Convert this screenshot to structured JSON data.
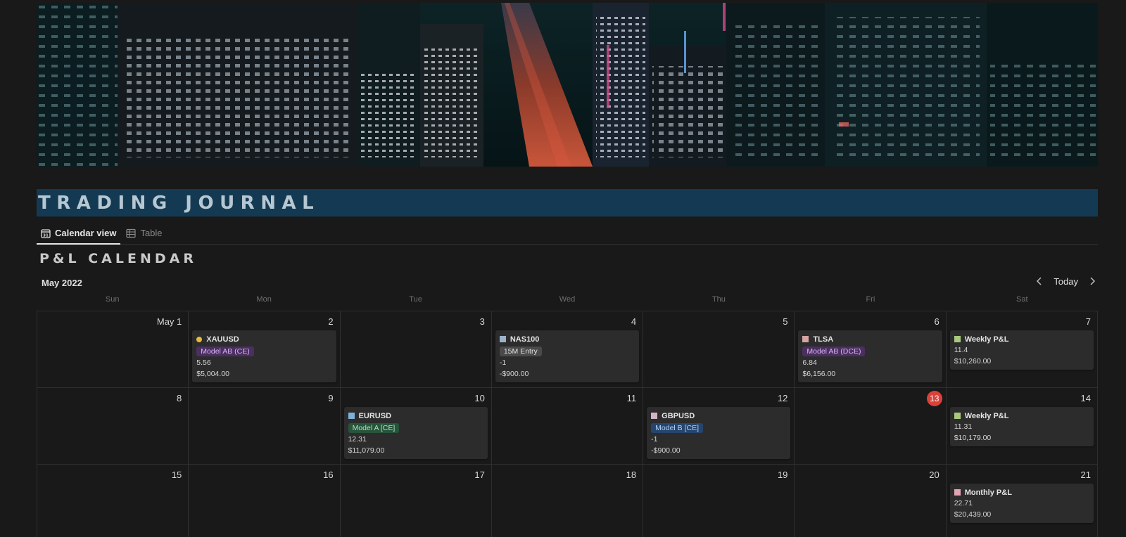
{
  "page": {
    "title": "TRADING JOURNAL"
  },
  "tabs": [
    {
      "label": "Calendar view",
      "icon": "calendar-icon",
      "active": true
    },
    {
      "label": "Table",
      "icon": "table-icon",
      "active": false
    }
  ],
  "calendar": {
    "title": "P&L CALENDAR",
    "month_label": "May 2022",
    "today_label": "Today",
    "weekdays": [
      "Sun",
      "Mon",
      "Tue",
      "Wed",
      "Thu",
      "Fri",
      "Sat"
    ],
    "today_day": "13",
    "days": [
      "May 1",
      "2",
      "3",
      "4",
      "5",
      "6",
      "7",
      "8",
      "9",
      "10",
      "11",
      "12",
      "13",
      "14",
      "15",
      "16",
      "17",
      "18",
      "19",
      "20",
      "21"
    ]
  },
  "entries": {
    "d2": {
      "name": "XAUUSD",
      "icon_color": "#e8b93a",
      "tag": "Model AB (CE)",
      "tag_bg": "#4b2f61",
      "tag_fg": "#d7b6f2",
      "value": "5.56",
      "pnl": "$5,004.00"
    },
    "d4": {
      "name": "NAS100",
      "icon_color": "#9bb3c8",
      "tag": "15M Entry",
      "tag_bg": "#4a4a4a",
      "tag_fg": "#e0e0e0",
      "value": "-1",
      "pnl": "-$900.00"
    },
    "d6": {
      "name": "TLSA",
      "icon_color": "#d5a3a3",
      "tag": "Model AB (DCE)",
      "tag_bg": "#4b2f61",
      "tag_fg": "#d7b6f2",
      "value": "6.84",
      "pnl": "$6,156.00"
    },
    "d7": {
      "name": "Weekly P&L",
      "icon_color": "#a8c97c",
      "value": "11.4",
      "pnl": "$10,260.00"
    },
    "d10": {
      "name": "EURUSD",
      "icon_color": "#7fb0d8",
      "tag": "Model A [CE]",
      "tag_bg": "#27543a",
      "tag_fg": "#a9e3bf",
      "value": "12.31",
      "pnl": "$11,079.00"
    },
    "d12": {
      "name": "GBPUSD",
      "icon_color": "#d3b3c8",
      "tag": "Model B [CE]",
      "tag_bg": "#25456e",
      "tag_fg": "#b3d3f5",
      "value": "-1",
      "pnl": "-$900.00"
    },
    "d14": {
      "name": "Weekly P&L",
      "icon_color": "#a8c97c",
      "value": "11.31",
      "pnl": "$10,179.00"
    },
    "d21": {
      "name": "Monthly P&L",
      "icon_color": "#e2a4b4",
      "value": "22.71",
      "pnl": "$20,439.00"
    }
  }
}
